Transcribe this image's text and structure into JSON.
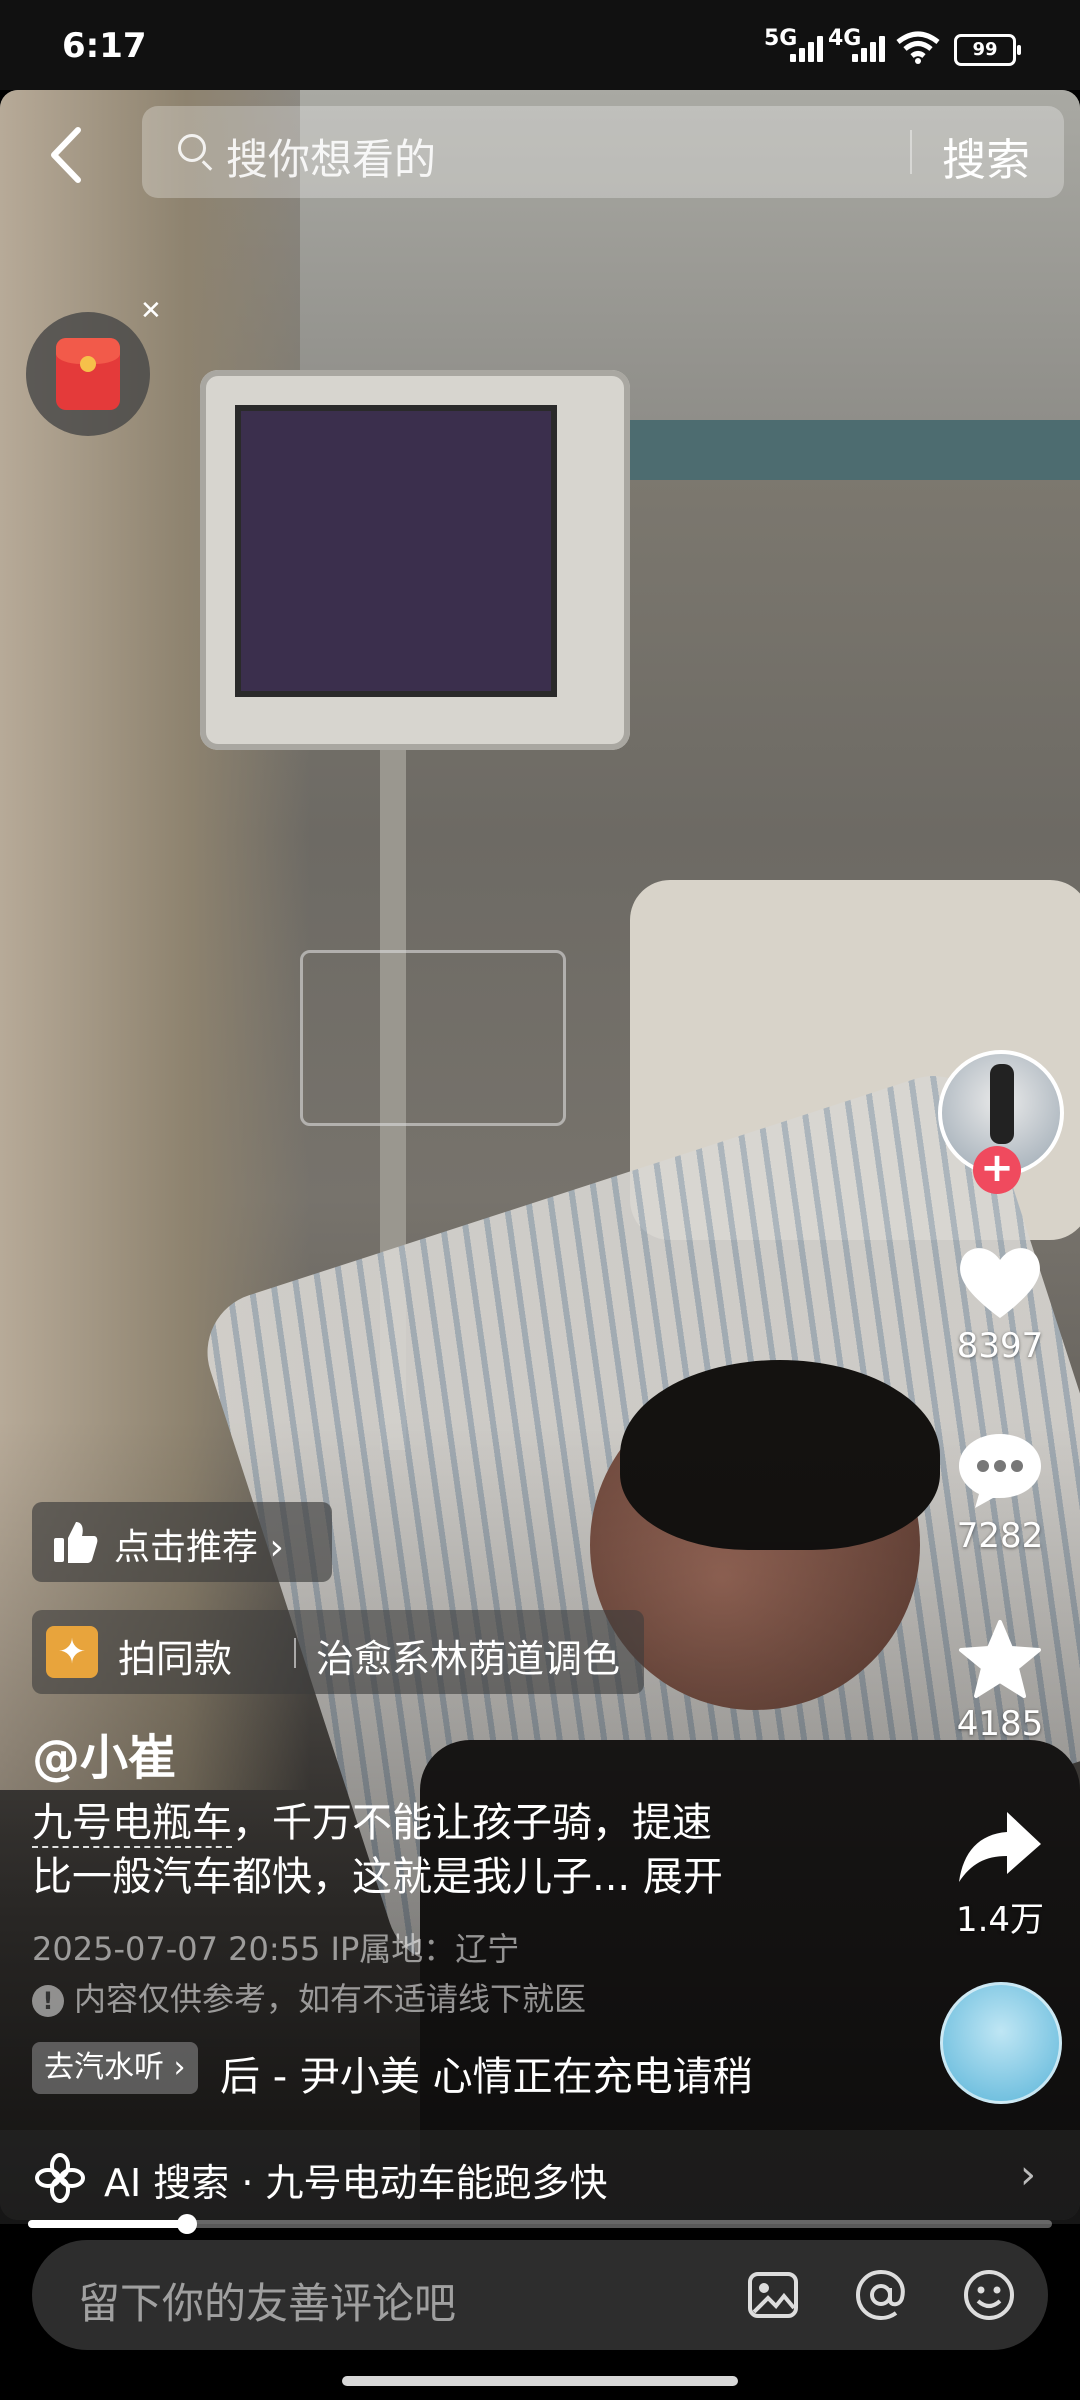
{
  "status_bar": {
    "time": "6:17",
    "net1": "5G",
    "net2": "4G",
    "battery": "99"
  },
  "search": {
    "placeholder": "搜你想看的",
    "button": "搜索"
  },
  "right_rail": {
    "likes": "8397",
    "comments": "7282",
    "favorites": "4185",
    "shares": "1.4万"
  },
  "recommend": {
    "label": "点击推荐 ›"
  },
  "same_style": {
    "label": "拍同款",
    "filter": "治愈系林荫道调色"
  },
  "post": {
    "author": "@小崔",
    "desc_keyword": "九号电瓶车",
    "desc_text": "，千万不能让孩子骑，提速",
    "desc_line2": "比一般汽车都快，这就是我儿子... 展开",
    "datetime_ip": "2025-07-07 20:55  IP属地：辽宁",
    "notice": "内容仅供参考，如有不适请线下就医"
  },
  "music": {
    "tag": "去汽水听 ›",
    "song": "后 - 尹小美    心情正在充电请稍"
  },
  "ai_search": {
    "label": "AI 搜索 · 九号电动车能跑多快"
  },
  "progress": {
    "fraction": 0.155
  },
  "comment_bar": {
    "placeholder": "留下你的友善评论吧"
  },
  "icons": [
    "back-arrow-icon",
    "search-icon",
    "red-packet-icon",
    "close-icon",
    "heart-icon",
    "comment-icon",
    "star-icon",
    "share-icon",
    "thumbs-up-icon",
    "sparkle-icon",
    "info-icon",
    "ai-flower-icon",
    "chevron-right-icon",
    "image-icon",
    "at-icon",
    "emoji-icon"
  ],
  "colors": {
    "follow": "#f04a5e",
    "accent_gold": "#e8a43c"
  }
}
